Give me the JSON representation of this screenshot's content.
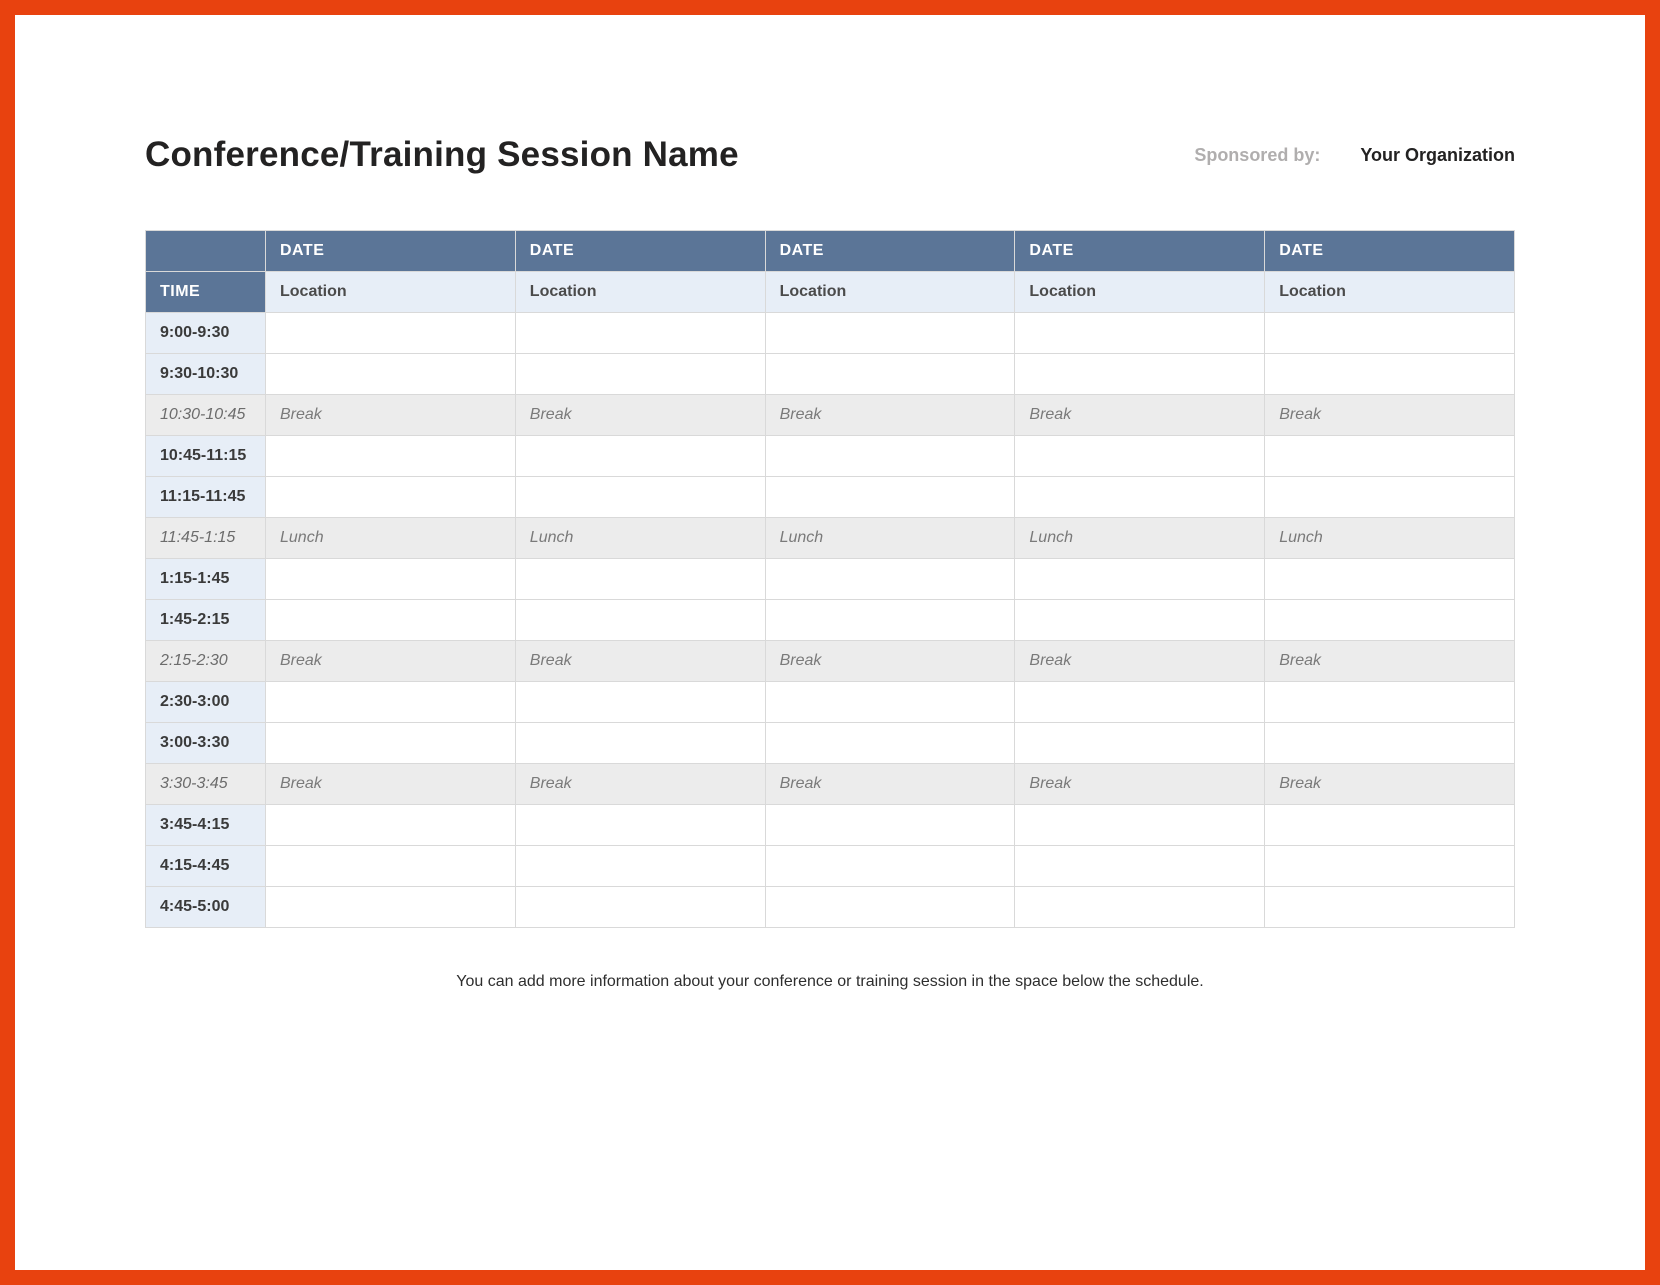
{
  "header": {
    "title": "Conference/Training Session Name",
    "sponsored_by_label": "Sponsored by:",
    "organization": "Your Organization"
  },
  "table": {
    "time_header": "TIME",
    "date_headers": [
      "DATE",
      "DATE",
      "DATE",
      "DATE",
      "DATE"
    ],
    "location_headers": [
      "Location",
      "Location",
      "Location",
      "Location",
      "Location"
    ],
    "rows": [
      {
        "time": "9:00-9:30",
        "special": false,
        "cells": [
          "",
          "",
          "",
          "",
          ""
        ]
      },
      {
        "time": "9:30-10:30",
        "special": false,
        "cells": [
          "",
          "",
          "",
          "",
          ""
        ]
      },
      {
        "time": "10:30-10:45",
        "special": true,
        "cells": [
          "Break",
          "Break",
          "Break",
          "Break",
          "Break"
        ]
      },
      {
        "time": "10:45-11:15",
        "special": false,
        "cells": [
          "",
          "",
          "",
          "",
          ""
        ]
      },
      {
        "time": "11:15-11:45",
        "special": false,
        "cells": [
          "",
          "",
          "",
          "",
          ""
        ]
      },
      {
        "time": "11:45-1:15",
        "special": true,
        "cells": [
          "Lunch",
          "Lunch",
          "Lunch",
          "Lunch",
          "Lunch"
        ]
      },
      {
        "time": "1:15-1:45",
        "special": false,
        "cells": [
          "",
          "",
          "",
          "",
          ""
        ]
      },
      {
        "time": "1:45-2:15",
        "special": false,
        "cells": [
          "",
          "",
          "",
          "",
          ""
        ]
      },
      {
        "time": "2:15-2:30",
        "special": true,
        "cells": [
          "Break",
          "Break",
          "Break",
          "Break",
          "Break"
        ]
      },
      {
        "time": "2:30-3:00",
        "special": false,
        "cells": [
          "",
          "",
          "",
          "",
          ""
        ]
      },
      {
        "time": "3:00-3:30",
        "special": false,
        "cells": [
          "",
          "",
          "",
          "",
          ""
        ]
      },
      {
        "time": "3:30-3:45",
        "special": true,
        "cells": [
          "Break",
          "Break",
          "Break",
          "Break",
          "Break"
        ]
      },
      {
        "time": "3:45-4:15",
        "special": false,
        "cells": [
          "",
          "",
          "",
          "",
          ""
        ]
      },
      {
        "time": "4:15-4:45",
        "special": false,
        "cells": [
          "",
          "",
          "",
          "",
          ""
        ]
      },
      {
        "time": "4:45-5:00",
        "special": false,
        "cells": [
          "",
          "",
          "",
          "",
          ""
        ]
      }
    ]
  },
  "footer": {
    "note": "You can add more information about your conference or training session in the space below the schedule."
  }
}
